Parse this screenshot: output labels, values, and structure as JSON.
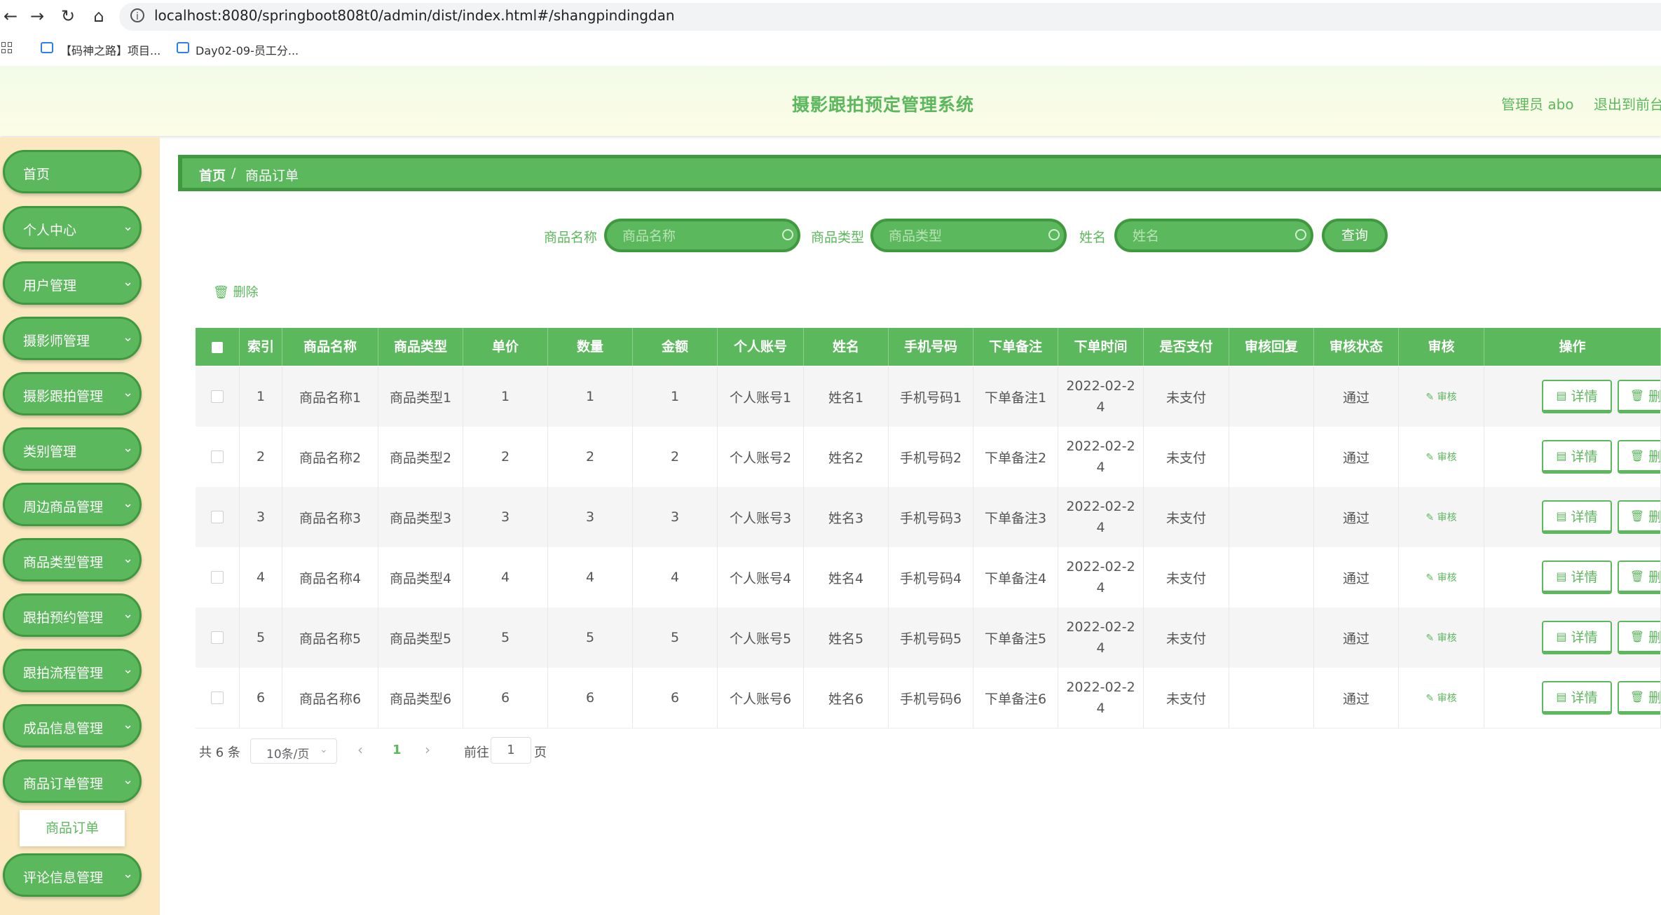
{
  "browser": {
    "url": "localhost:8080/springboot808t0/admin/dist/index.html#/shangpindingdan",
    "bookmarks": [
      "【码神之路】项目...",
      "Day02-09-员工分..."
    ]
  },
  "header": {
    "title": "摄影跟拍预定管理系统",
    "admin": "管理员 abo",
    "exit": "退出到前台"
  },
  "sidebar": {
    "items": [
      {
        "label": "首页",
        "has_chevron": false
      },
      {
        "label": "个人中心",
        "has_chevron": true
      },
      {
        "label": "用户管理",
        "has_chevron": true
      },
      {
        "label": "摄影师管理",
        "has_chevron": true
      },
      {
        "label": "摄影跟拍管理",
        "has_chevron": true
      },
      {
        "label": "类别管理",
        "has_chevron": true
      },
      {
        "label": "周边商品管理",
        "has_chevron": true
      },
      {
        "label": "商品类型管理",
        "has_chevron": true
      },
      {
        "label": "跟拍预约管理",
        "has_chevron": true
      },
      {
        "label": "跟拍流程管理",
        "has_chevron": true
      },
      {
        "label": "成品信息管理",
        "has_chevron": true
      },
      {
        "label": "商品订单管理",
        "has_chevron": true
      },
      {
        "label": "评论信息管理",
        "has_chevron": true
      }
    ],
    "sub_item": "商品订单"
  },
  "breadcrumb": {
    "home": "首页",
    "sep": "/",
    "current": "商品订单"
  },
  "search": {
    "fields": [
      {
        "label": "商品名称",
        "placeholder": "商品名称"
      },
      {
        "label": "商品类型",
        "placeholder": "商品类型"
      },
      {
        "label": "姓名",
        "placeholder": "姓名"
      }
    ],
    "query_label": "查询"
  },
  "toolbar": {
    "delete_label": "删除"
  },
  "table": {
    "columns": [
      "",
      "索引",
      "商品名称",
      "商品类型",
      "单价",
      "数量",
      "金额",
      "个人账号",
      "姓名",
      "手机号码",
      "下单备注",
      "下单时间",
      "是否支付",
      "审核回复",
      "审核状态",
      "审核",
      "操作"
    ],
    "rows": [
      [
        "1",
        "商品名称1",
        "商品类型1",
        "1",
        "1",
        "1",
        "个人账号1",
        "姓名1",
        "手机号码1",
        "下单备注1",
        "2022-02-24",
        "未支付",
        "",
        "通过"
      ],
      [
        "2",
        "商品名称2",
        "商品类型2",
        "2",
        "2",
        "2",
        "个人账号2",
        "姓名2",
        "手机号码2",
        "下单备注2",
        "2022-02-24",
        "未支付",
        "",
        "通过"
      ],
      [
        "3",
        "商品名称3",
        "商品类型3",
        "3",
        "3",
        "3",
        "个人账号3",
        "姓名3",
        "手机号码3",
        "下单备注3",
        "2022-02-24",
        "未支付",
        "",
        "通过"
      ],
      [
        "4",
        "商品名称4",
        "商品类型4",
        "4",
        "4",
        "4",
        "个人账号4",
        "姓名4",
        "手机号码4",
        "下单备注4",
        "2022-02-24",
        "未支付",
        "",
        "通过"
      ],
      [
        "5",
        "商品名称5",
        "商品类型5",
        "5",
        "5",
        "5",
        "个人账号5",
        "姓名5",
        "手机号码5",
        "下单备注5",
        "2022-02-24",
        "未支付",
        "",
        "通过"
      ],
      [
        "6",
        "商品名称6",
        "商品类型6",
        "6",
        "6",
        "6",
        "个人账号6",
        "姓名6",
        "手机号码6",
        "下单备注6",
        "2022-02-24",
        "未支付",
        "",
        "通过"
      ]
    ],
    "audit_label": "审核",
    "detail_label": "详情",
    "delete_label": "删除"
  },
  "pagination": {
    "total": "共 6 条",
    "page_size": "10条/页",
    "current_page": "1",
    "goto_label": "前往",
    "goto_value": "1",
    "goto_unit": "页"
  },
  "colors": {
    "accent": "#5cb85c",
    "accent_dark": "#3f9a3f",
    "sidebar_bg": "#fbe8c0"
  }
}
